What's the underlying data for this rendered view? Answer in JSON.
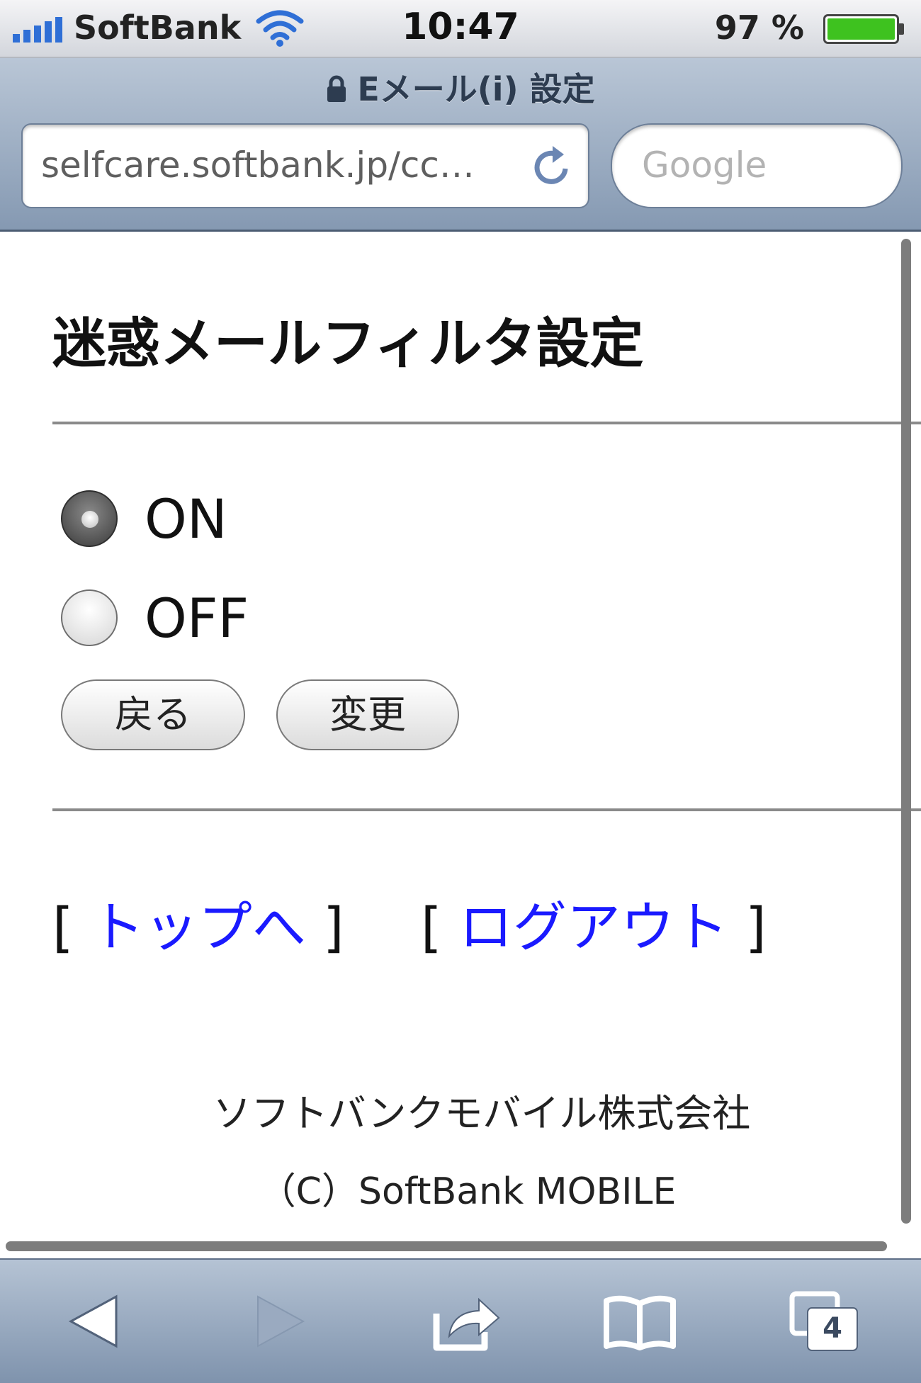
{
  "status_bar": {
    "carrier": "SoftBank",
    "time": "10:47",
    "battery_percent": "97 %"
  },
  "nav_bar": {
    "page_title": "Eメール(i) 設定",
    "url": "selfcare.softbank.jp/cc…",
    "search_placeholder": "Google"
  },
  "page": {
    "heading": "迷惑メールフィルタ設定",
    "radio_on_label": "ON",
    "radio_off_label": "OFF",
    "selected": "ON",
    "back_button": "戻る",
    "change_button": "変更",
    "link_open_bracket": "[",
    "link_close_bracket": "]",
    "link_top": "トップへ",
    "link_logout": "ログアウト",
    "company": "ソフトバンクモバイル株式会社",
    "copyright": "（C）SoftBank MOBILE"
  },
  "toolbar": {
    "tabs_count": "4",
    "icons": [
      "back-arrow-icon",
      "forward-arrow-icon",
      "share-icon",
      "bookmarks-icon",
      "tabs-icon"
    ]
  },
  "colors": {
    "link": "#1a1aff",
    "battery": "#3ec21f",
    "signal": "#2f6fd6"
  }
}
